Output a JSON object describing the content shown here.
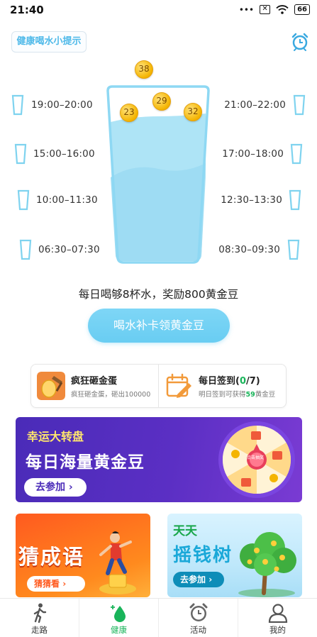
{
  "status_bar": {
    "time": "21:40",
    "dots": "•••",
    "battery": "66"
  },
  "header": {
    "tip_label": "健康喝水小提示"
  },
  "slots_left": [
    "19:00–20:00",
    "15:00–16:00",
    "10:00–11:30",
    "06:30–07:30"
  ],
  "slots_right": [
    "21:00–22:00",
    "17:00–18:00",
    "12:30–13:30",
    "08:30–09:30"
  ],
  "coins": [
    "38",
    "29",
    "23",
    "32"
  ],
  "reward_text": "每日喝够8杯水，奖励800黄金豆",
  "makeup_button": "喝水补卡领黄金豆",
  "tasks": {
    "egg": {
      "title": "疯狂砸金蛋",
      "sub": "疯狂砸金蛋，砸出100000"
    },
    "signin": {
      "title_prefix": "每日签到(",
      "count": "0",
      "title_suffix": "/7)",
      "sub_prefix": "明日签到可获得",
      "sub_value": "59",
      "sub_suffix": "黄金豆"
    }
  },
  "banner": {
    "tag": "幸运大转盘",
    "title": "每日海量黄金豆",
    "button": "去参加",
    "wheel_center": "点击抽奖"
  },
  "promo_idiom": {
    "title": "猜成语",
    "button": "猜猜看"
  },
  "promo_tree": {
    "tag": "天天",
    "title": "摇钱树",
    "button": "去参加"
  },
  "bottom_nav": [
    {
      "label": "走路",
      "icon": "walking-person-icon"
    },
    {
      "label": "健康",
      "icon": "water-drop-icon"
    },
    {
      "label": "活动",
      "icon": "alarm-clock-icon"
    },
    {
      "label": "我的",
      "icon": "user-icon"
    }
  ],
  "colors": {
    "accent_blue": "#69cdf2",
    "water": "#aee4f6",
    "green": "#19b45a",
    "banner_purple": "#4a2bb8"
  }
}
